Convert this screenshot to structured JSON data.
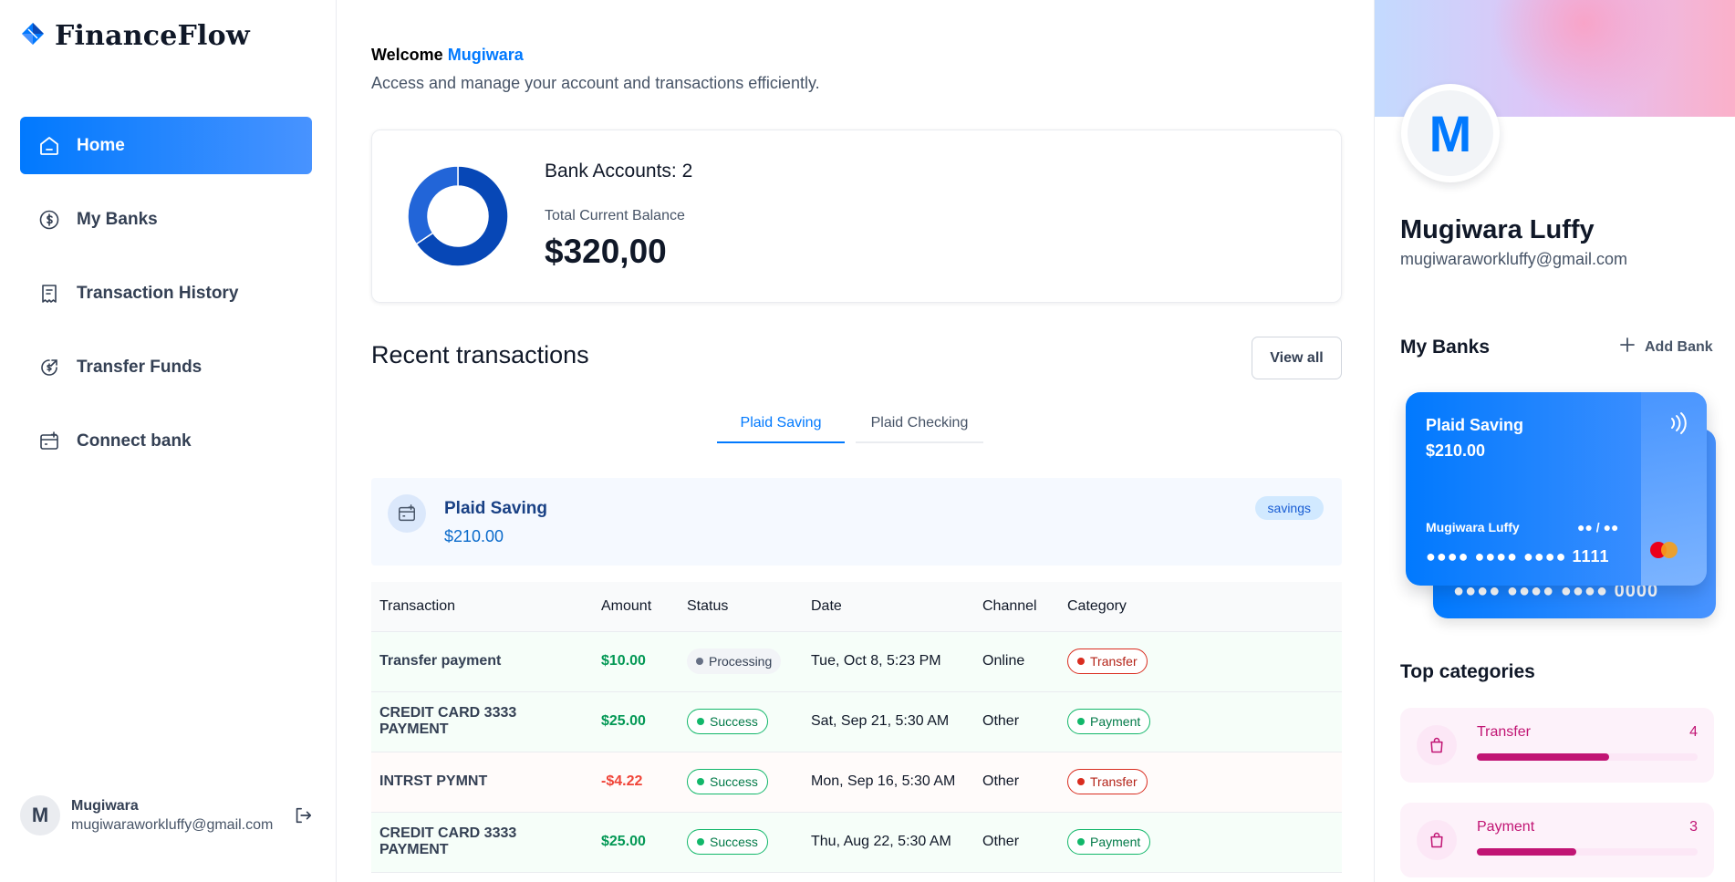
{
  "app": {
    "name": "FinanceFlow"
  },
  "sidebar": {
    "items": [
      {
        "label": "Home",
        "icon": "home-icon",
        "active": true
      },
      {
        "label": "My Banks",
        "icon": "dollar-circle-icon"
      },
      {
        "label": "Transaction History",
        "icon": "receipt-icon"
      },
      {
        "label": "Transfer Funds",
        "icon": "money-send-icon"
      },
      {
        "label": "Connect bank",
        "icon": "card-add-icon"
      }
    ],
    "user": {
      "initial": "M",
      "name": "Mugiwara",
      "email": "mugiwaraworkluffy@gmail.com"
    }
  },
  "header": {
    "welcome": "Welcome",
    "user_name": "Mugiwara",
    "subtitle": "Access and manage your account and transactions efficiently."
  },
  "balance": {
    "bank_accounts": "Bank Accounts: 2",
    "total_label": "Total Current Balance",
    "total_value": "$320,00",
    "donut_share": [
      0.656,
      0.344
    ],
    "colors": [
      "#0747b6",
      "#2265d8"
    ]
  },
  "recent": {
    "title": "Recent transactions",
    "view_all": "View all",
    "tabs": [
      {
        "label": "Plaid Saving",
        "active": true
      },
      {
        "label": "Plaid Checking",
        "active": false
      }
    ],
    "account": {
      "name": "Plaid Saving",
      "amount": "$210.00",
      "type": "savings"
    },
    "columns": [
      "Transaction",
      "Amount",
      "Status",
      "Date",
      "Channel",
      "Category"
    ],
    "rows": [
      {
        "name": "Transfer payment",
        "amount": "$10.00",
        "sign": "pos",
        "status": "Processing",
        "status_kind": "processing",
        "date": "Tue, Oct 8, 5:23 PM",
        "channel": "Online",
        "category": "Transfer",
        "category_kind": "transfer"
      },
      {
        "name": "CREDIT CARD 3333 PAYMENT",
        "amount": "$25.00",
        "sign": "pos",
        "status": "Success",
        "status_kind": "success",
        "date": "Sat, Sep 21, 5:30 AM",
        "channel": "Other",
        "category": "Payment",
        "category_kind": "payment"
      },
      {
        "name": "INTRST PYMNT",
        "amount": "-$4.22",
        "sign": "neg",
        "status": "Success",
        "status_kind": "success",
        "date": "Mon, Sep 16, 5:30 AM",
        "channel": "Other",
        "category": "Transfer",
        "category_kind": "transfer"
      },
      {
        "name": "CREDIT CARD 3333 PAYMENT",
        "amount": "$25.00",
        "sign": "pos",
        "status": "Success",
        "status_kind": "success",
        "date": "Thu, Aug 22, 5:30 AM",
        "channel": "Other",
        "category": "Payment",
        "category_kind": "payment"
      }
    ]
  },
  "profile": {
    "initial": "M",
    "name": "Mugiwara Luffy",
    "email": "mugiwaraworkluffy@gmail.com"
  },
  "my_banks": {
    "title": "My Banks",
    "add_label": "Add Bank",
    "card": {
      "name": "Plaid Saving",
      "balance": "$210.00",
      "holder": "Mugiwara Luffy",
      "expiry": "●● / ●●",
      "number": "●●●● ●●●● ●●●● 1111"
    },
    "back_card_number": "●●●● ●●●● ●●●● 0000"
  },
  "top_categories": {
    "title": "Top categories",
    "items": [
      {
        "name": "Transfer",
        "count": "4",
        "fill": 0.6
      },
      {
        "name": "Payment",
        "count": "3",
        "fill": 0.45
      }
    ]
  }
}
